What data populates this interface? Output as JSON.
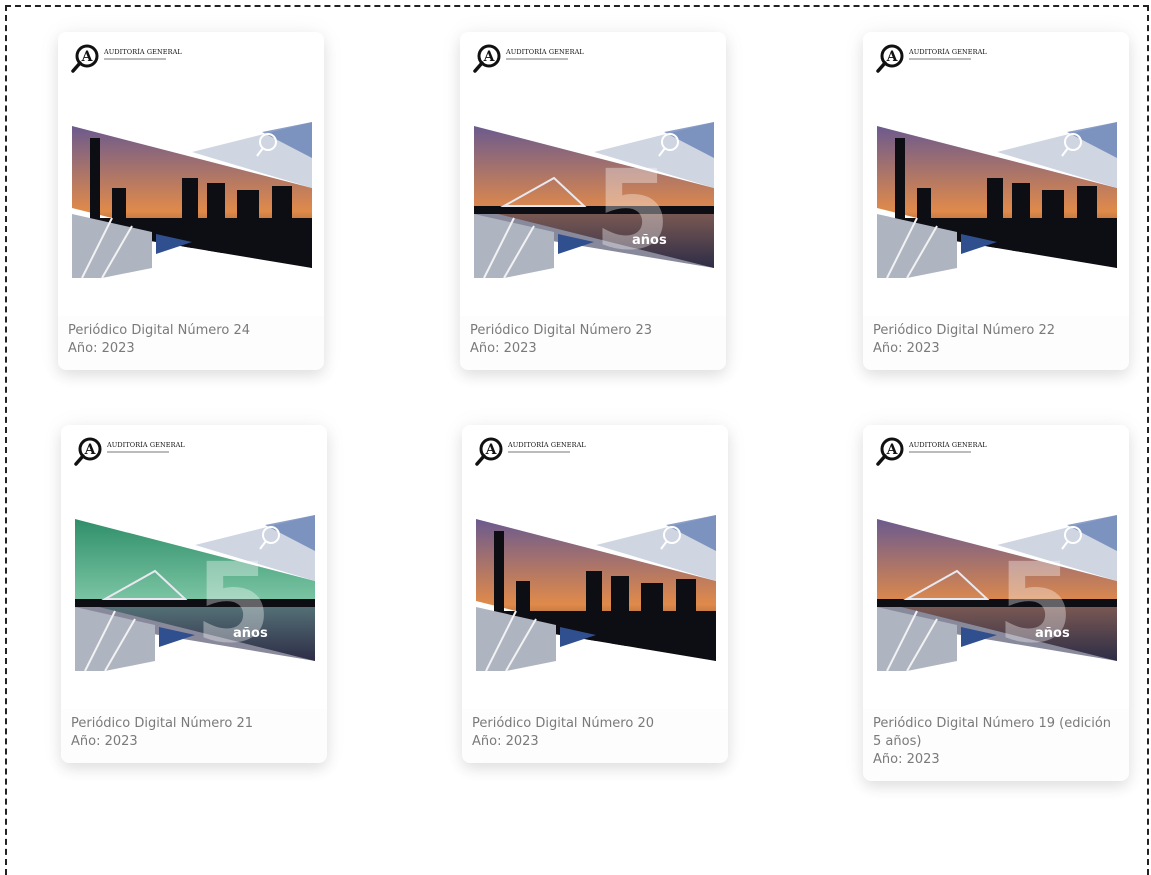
{
  "logo": {
    "name": "AUDITORÍA GENERAL"
  },
  "publications": [
    {
      "title": "Periódico Digital Número 24",
      "year": "Año: 2023",
      "cover": "city-night",
      "badge": ""
    },
    {
      "title": "Periódico Digital Número 23",
      "year": "Año: 2023",
      "cover": "bridge-purple",
      "badge": "años"
    },
    {
      "title": "Periódico Digital Número 22",
      "year": "Año: 2023",
      "cover": "city-night",
      "badge": ""
    },
    {
      "title": "Periódico Digital Número 21",
      "year": "Año: 2023",
      "cover": "bridge-green",
      "badge": "años"
    },
    {
      "title": "Periódico Digital Número 20",
      "year": "Año: 2023",
      "cover": "city-night",
      "badge": ""
    },
    {
      "title": "Periódico Digital Número 19 (edición 5 años)",
      "year": "Año: 2023",
      "cover": "bridge-purple",
      "badge": "años"
    }
  ],
  "colors": {
    "caption_text": "#7a7a7a",
    "sky_purple": "#6b5a8e",
    "sky_orange": "#e08a4a",
    "sky_green": "#2f8f6a",
    "accent_blue": "#2f4f8f"
  }
}
